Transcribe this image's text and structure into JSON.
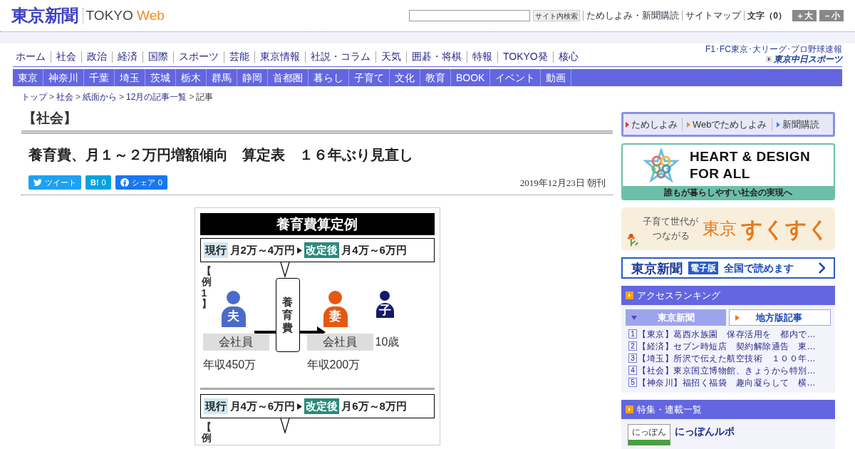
{
  "header": {
    "logo": "東京新聞",
    "brand": "TOKYO",
    "brand_accent": "Web",
    "search_button": "サイト内検索",
    "links": [
      "ためしよみ・新聞購読",
      "サイトマップ"
    ],
    "text_size": "文字（0）",
    "size_buttons": [
      "＋大",
      "－小"
    ]
  },
  "nav_main": {
    "items": [
      "ホーム",
      "社会",
      "政治",
      "経済",
      "国際",
      "スポーツ",
      "芸能",
      "東京情報",
      "社説・コラム",
      "天気",
      "囲碁・将棋",
      "特報",
      "TOKYO発",
      "核心"
    ],
    "sports_caption": "F1･FC東京･大リーグ･プロ野球速報",
    "sports_logo": "東京中日スポーツ"
  },
  "nav_sub": {
    "items": [
      "東京",
      "神奈川",
      "千葉",
      "埼玉",
      "茨城",
      "栃木",
      "群馬",
      "静岡",
      "首都圏",
      "暮らし",
      "子育て",
      "文化",
      "教育",
      "BOOK",
      "イベント",
      "動画"
    ]
  },
  "breadcrumb": {
    "items": [
      "トップ",
      "社会",
      "紙面から",
      "12月の記事一覧",
      "記事"
    ],
    "separator": ">"
  },
  "article": {
    "category": "【社会】",
    "headline": "養育費、月１～２万円増額傾向　算定表　１６年ぶり見直し",
    "share": [
      {
        "kind": "twitter",
        "label": "ツイート"
      },
      {
        "kind": "hatena",
        "label": "B!",
        "count": "0"
      },
      {
        "kind": "facebook",
        "label": "シェア",
        "count": "0"
      }
    ],
    "date": "2019年12月23日 朝刊",
    "infographic": {
      "title": "養育費算定例",
      "sections": [
        {
          "current_tag": "現行",
          "current": "月2万～4万円",
          "revised_tag": "改定後",
          "revised": "月4万～6万円",
          "example": "【例1】",
          "payer": {
            "role": "夫",
            "job": "会社員",
            "income": "年収450万"
          },
          "flow": "養育費",
          "payee": {
            "role": "妻",
            "job": "会社員",
            "income": "年収200万"
          },
          "child": {
            "role": "子",
            "age": "10歳"
          }
        },
        {
          "current_tag": "現行",
          "current": "月4万～6万円",
          "revised_tag": "改定後",
          "revised": "月6万～8万円",
          "example": "【例"
        }
      ]
    }
  },
  "sidebar": {
    "promo_links": [
      {
        "label": "ためしよみ",
        "color": "#e8322c"
      },
      {
        "label": "Webでためしよみ",
        "color": "#f08a1c"
      },
      {
        "label": "新聞購読",
        "color": "#2f8fe0"
      }
    ],
    "heart_banner": {
      "title_1": "HEART & DESIGN",
      "title_2": "FOR ALL",
      "caption": "誰もが暮らしやすい社会の実現へ"
    },
    "sukusuku_banner": {
      "line_1": "子育て世代が",
      "line_2": "つながる",
      "place": "東京",
      "name": "すくすく"
    },
    "epaper_banner": {
      "logo": "東京新聞",
      "tag": "電子版",
      "text": "全国で読めます"
    },
    "ranking": {
      "title": "アクセスランキング",
      "tabs": [
        {
          "label": "東京新聞",
          "selected": true
        },
        {
          "label": "地方版記事",
          "selected": false
        }
      ],
      "items": [
        {
          "rank": "1",
          "text": "【東京】葛西水族園　保存活用を　都内で…"
        },
        {
          "rank": "2",
          "text": "【経済】セブン時短店　契約解除通告　東…"
        },
        {
          "rank": "3",
          "text": "【埼玉】所沢で伝えた航空技術　１００年…"
        },
        {
          "rank": "4",
          "text": "【社会】東京国立博物館、きょうから特別…"
        },
        {
          "rank": "5",
          "text": "【神奈川】福招く福袋　趣向凝らして　横…"
        }
      ]
    },
    "features": {
      "title": "特集・連載一覧",
      "items": [
        {
          "thumb": "にっぽん",
          "title": "にっぽんルポ"
        }
      ]
    }
  }
}
